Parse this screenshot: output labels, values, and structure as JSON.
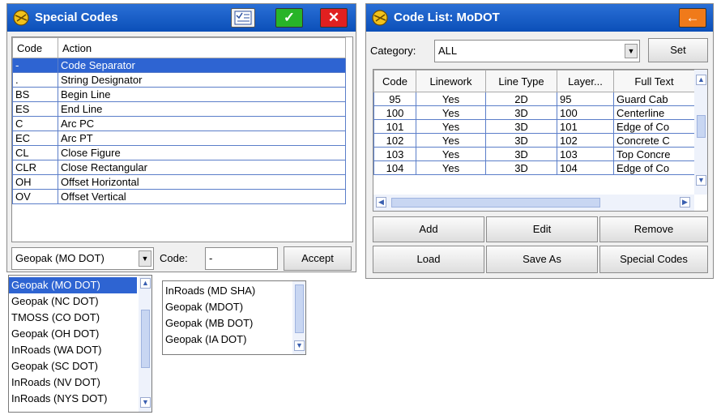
{
  "special_codes": {
    "title": "Special Codes",
    "header": {
      "code": "Code",
      "action": "Action"
    },
    "rows": [
      {
        "code": "-",
        "action": "Code Separator"
      },
      {
        "code": ".",
        "action": "String Designator"
      },
      {
        "code": "BS",
        "action": "Begin Line"
      },
      {
        "code": "ES",
        "action": "End Line"
      },
      {
        "code": "C",
        "action": "Arc PC"
      },
      {
        "code": "EC",
        "action": "Arc PT"
      },
      {
        "code": "CL",
        "action": "Close Figure"
      },
      {
        "code": "CLR",
        "action": "Close Rectangular"
      },
      {
        "code": "OH",
        "action": "Offset Horizontal"
      },
      {
        "code": "OV",
        "action": "Offset Vertical"
      }
    ],
    "selected_style": "Geopak (MO DOT)",
    "code_label": "Code:",
    "code_value": "-",
    "accept_label": "Accept",
    "dropdown_items": [
      "Geopak (MO DOT)",
      "Geopak (NC DOT)",
      "TMOSS (CO DOT)",
      "Geopak (OH DOT)",
      "InRoads (WA DOT)",
      "Geopak (SC DOT)",
      "InRoads (NV DOT)",
      "InRoads (NYS DOT)"
    ],
    "dropdown_items_2": [
      "InRoads (MD SHA)",
      "Geopak (MDOT)",
      "Geopak (MB DOT)",
      "Geopak (IA DOT)"
    ]
  },
  "code_list": {
    "title": "Code List: MoDOT",
    "category_label": "Category:",
    "category_value": "ALL",
    "set_label": "Set",
    "columns": [
      "Code",
      "Linework",
      "Line Type",
      "Layer...",
      "Full Text"
    ],
    "rows": [
      [
        "95",
        "Yes",
        "2D",
        "95",
        "Guard Cab"
      ],
      [
        "100",
        "Yes",
        "3D",
        "100",
        "Centerline"
      ],
      [
        "101",
        "Yes",
        "3D",
        "101",
        "Edge of Co"
      ],
      [
        "102",
        "Yes",
        "3D",
        "102",
        "Concrete C"
      ],
      [
        "103",
        "Yes",
        "3D",
        "103",
        "Top Concre"
      ],
      [
        "104",
        "Yes",
        "3D",
        "104",
        "Edge of Co"
      ]
    ],
    "buttons": {
      "add": "Add",
      "edit": "Edit",
      "remove": "Remove",
      "load": "Load",
      "save_as": "Save As",
      "special_codes": "Special Codes"
    }
  },
  "colors": {
    "title_bar": "#1560c8",
    "selection": "#2e64d2",
    "ok_green": "#28b428",
    "close_red": "#e02020",
    "back_orange": "#f07a1a"
  }
}
